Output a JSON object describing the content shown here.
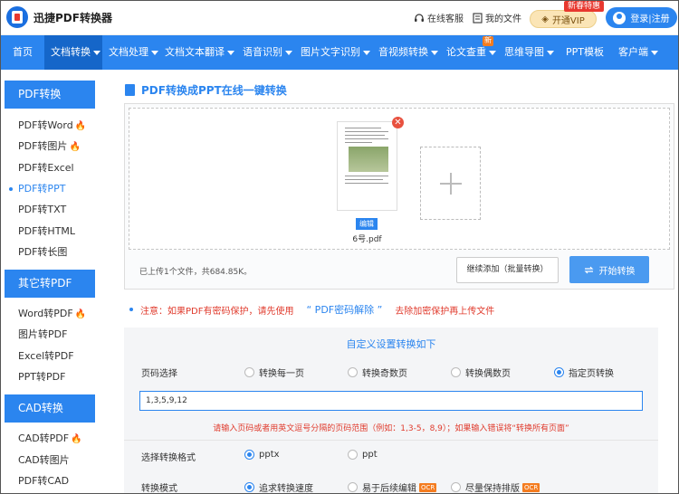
{
  "header": {
    "app_title": "迅捷PDF转换器",
    "online_service": "在线客服",
    "my_files": "我的文件",
    "vip_label": "开通VIP",
    "vip_tag": "新春特惠",
    "login_label": "登录|注册"
  },
  "nav": {
    "items": [
      {
        "label": "首页"
      },
      {
        "label": "文档转换"
      },
      {
        "label": "文档处理"
      },
      {
        "label": "文档文本翻译"
      },
      {
        "label": "语音识别"
      },
      {
        "label": "图片文字识别"
      },
      {
        "label": "音视频转换"
      },
      {
        "label": "论文查重",
        "badge": "新"
      },
      {
        "label": "思维导图"
      },
      {
        "label": "PPT模板"
      },
      {
        "label": "客户端"
      }
    ]
  },
  "sidebar": {
    "group1": "PDF转换",
    "group1_items": [
      "PDF转Word",
      "PDF转图片",
      "PDF转Excel",
      "PDF转PPT",
      "PDF转TXT",
      "PDF转HTML",
      "PDF转长图"
    ],
    "group2": "其它转PDF",
    "group2_items": [
      "Word转PDF",
      "图片转PDF",
      "Excel转PDF",
      "PPT转PDF"
    ],
    "group3": "CAD转换",
    "group3_items": [
      "CAD转PDF",
      "CAD转图片",
      "PDF转CAD"
    ]
  },
  "main": {
    "title": "PDF转换成PPT在线一键转换",
    "edit_tag": "编辑",
    "file_name": "6号.pdf",
    "uploaded_info": "已上传1个文件，共684.85K。",
    "add_more_label": "继续添加（批量转换）",
    "start_label": "开始转换",
    "notice_pre": "注意：如果PDF有密码保护，请先使用",
    "notice_link": "“ PDF密码解除 ”",
    "notice_post": "去除加密保护再上传文件"
  },
  "settings": {
    "title": "自定义设置转换如下",
    "page_label": "页码选择",
    "page_options": [
      "转换每一页",
      "转换奇数页",
      "转换偶数页",
      "指定页转换"
    ],
    "page_input_value": "1,3,5,9,12",
    "hint": "请输入页码或者用英文逗号分隔的页码范围（例如：1,3-5，8,9）；如果输入错误将“转换所有页面”",
    "format_label": "选择转换格式",
    "format_options": [
      "pptx",
      "ppt"
    ],
    "mode_label": "转换模式",
    "mode_options": [
      "追求转换速度",
      "易于后续编辑",
      "尽量保持排版"
    ],
    "ocr_tag": "OCR"
  },
  "colors": {
    "brand": "#2b85ef",
    "nav_active": "#1566c9",
    "warning": "#e03b2d",
    "hot": "#f47c20"
  }
}
